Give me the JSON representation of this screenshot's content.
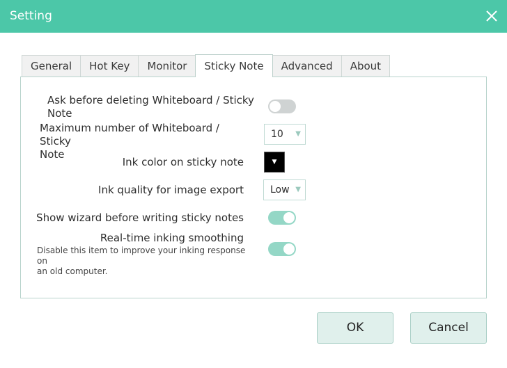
{
  "window": {
    "title": "Setting"
  },
  "tabs": [
    {
      "label": "General"
    },
    {
      "label": "Hot Key"
    },
    {
      "label": "Monitor"
    },
    {
      "label": "Sticky Note"
    },
    {
      "label": "Advanced"
    },
    {
      "label": "About"
    }
  ],
  "active_tab": "Sticky Note",
  "settings": {
    "ask_before_deleting": {
      "label_line1": "Ask before deleting Whiteboard / Sticky",
      "label_line2": "Note",
      "enabled": false
    },
    "max_number": {
      "label_line1": "Maximum number of Whiteboard / Sticky",
      "label_line2": "Note",
      "value": "10"
    },
    "ink_color": {
      "label": "Ink color on sticky note",
      "color": "#000000"
    },
    "ink_quality": {
      "label": "Ink quality for image export",
      "value": "Low"
    },
    "show_wizard": {
      "label": "Show wizard before writing sticky notes",
      "enabled": true
    },
    "realtime_smoothing": {
      "label": "Real-time inking smoothing",
      "desc_line1": "Disable this item to improve your inking response on",
      "desc_line2": "an old computer.",
      "enabled": true
    }
  },
  "buttons": {
    "ok": "OK",
    "cancel": "Cancel"
  },
  "colors": {
    "accent": "#4cc7a8",
    "toggle_on": "#94d7c6",
    "toggle_off": "#cfd3d3"
  }
}
